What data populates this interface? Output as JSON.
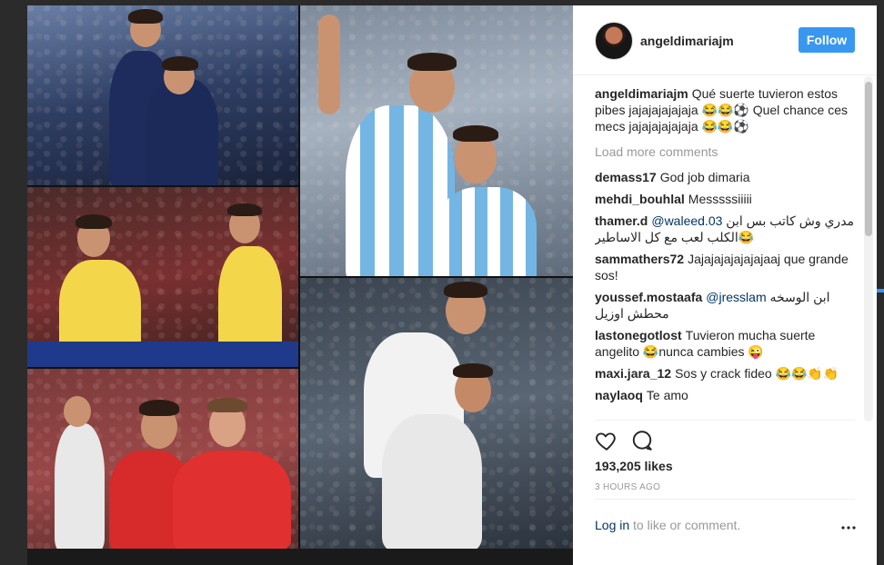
{
  "post": {
    "username": "angeldimariajm",
    "follow_label": "Follow"
  },
  "caption": {
    "author": "angeldimariajm",
    "text": "Qué suerte tuvieron estos pibes jajajajajajaja 😂😂⚽ Quel chance ces mecs jajajajajajaja 😂😂⚽"
  },
  "load_more_label": "Load more comments",
  "comments": [
    {
      "author": "demass17",
      "mention": "",
      "text": "God job dimaria"
    },
    {
      "author": "mehdi_bouhlal",
      "mention": "",
      "text": "Messsssiiiii"
    },
    {
      "author": "thamer.d",
      "mention": "@waleed.03",
      "text": "مدري وش كاتب بس ابن الكلب لعب مع كل الاساطير😂"
    },
    {
      "author": "sammathers72",
      "mention": "",
      "text": "Jajajajajajajajaaj que grande sos!"
    },
    {
      "author": "youssef.mostaafa",
      "mention": "@jresslam",
      "text": "ابن الوسخه محطش اوزيل"
    },
    {
      "author": "lastonegotlost",
      "mention": "",
      "text": "Tuvieron mucha suerte angelito 😂nunca cambies 😜"
    },
    {
      "author": "maxi.jara_12",
      "mention": "",
      "text": "Sos y crack fideo 😂😂👏👏"
    },
    {
      "author": "naylaoq",
      "mention": "",
      "text": "Te amo"
    }
  ],
  "likes": "193,205 likes",
  "timestamp": "3 HOURS AGO",
  "login": {
    "link_label": "Log in",
    "rest_text": "to like or comment."
  },
  "icons": {
    "like": "heart-icon",
    "comment": "comment-bubble-icon",
    "more": "ellipsis-icon"
  },
  "colors": {
    "accent": "#3897f0",
    "link": "#003569",
    "muted": "#999999",
    "text": "#262626"
  }
}
